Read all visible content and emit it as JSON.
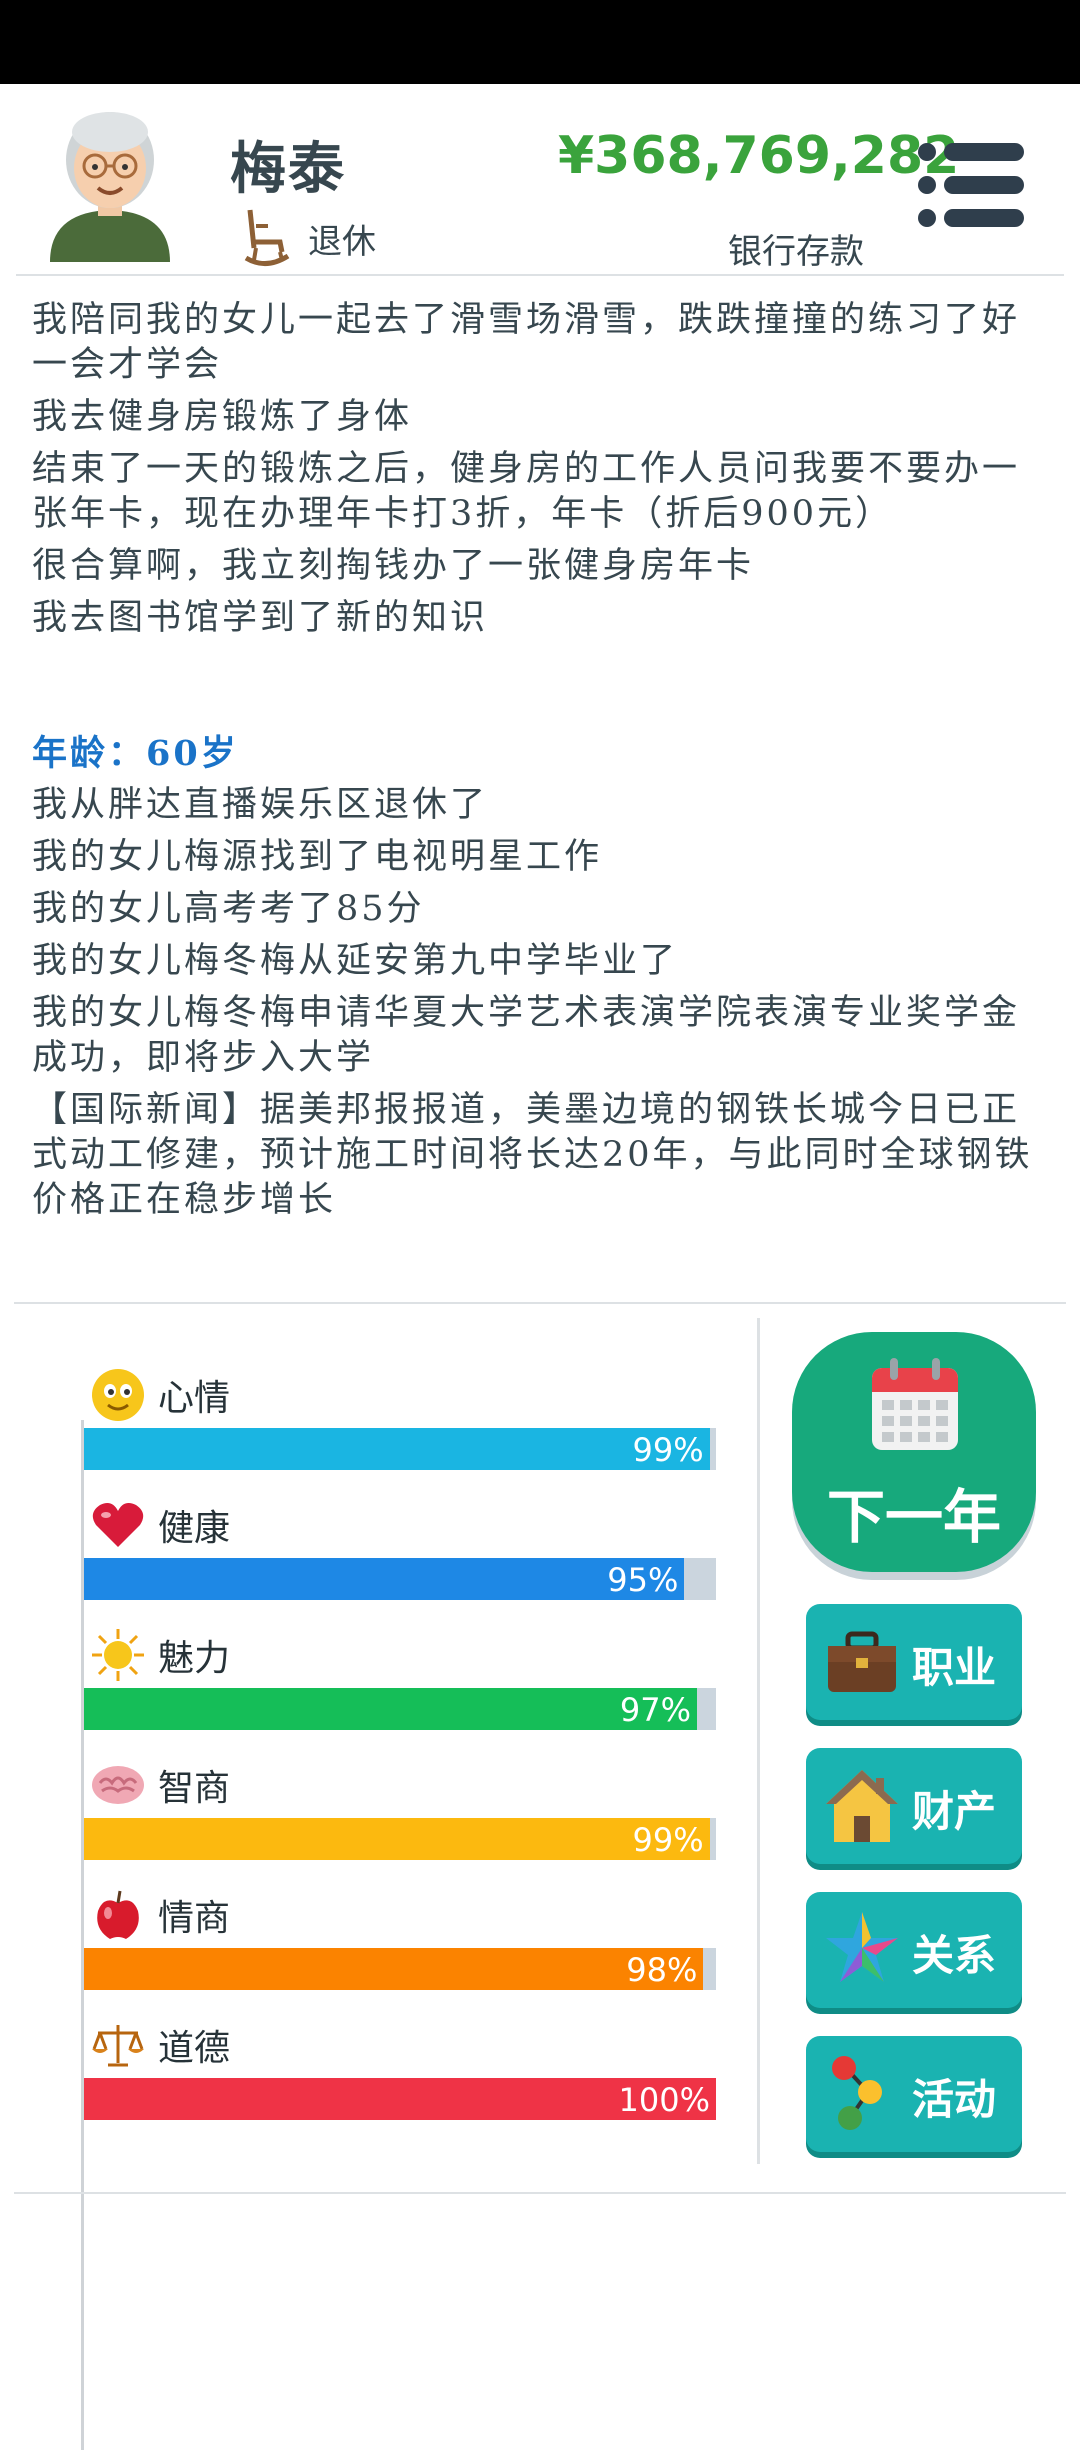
{
  "header": {
    "name": "梅泰",
    "status": "退休",
    "money": "¥368,769,282",
    "money_label": "银行存款"
  },
  "log": {
    "lines_before": [
      "我陪同我的女儿一起去了滑雪场滑雪，跌跌撞撞的练习了好一会才学会",
      "我去健身房锻炼了身体",
      "结束了一天的锻炼之后，健身房的工作人员问我要不要办一张年卡，现在办理年卡打3折，年卡（折后900元）",
      "很合算啊，我立刻掏钱办了一张健身房年卡",
      "我去图书馆学到了新的知识"
    ],
    "age_heading": "年龄：60岁",
    "lines_after": [
      "我从胖达直播娱乐区退休了",
      "我的女儿梅源找到了电视明星工作",
      "我的女儿高考考了85分",
      "我的女儿梅冬梅从延安第九中学毕业了",
      "我的女儿梅冬梅申请华夏大学艺术表演学院表演专业奖学金成功，即将步入大学",
      "【国际新闻】据美邦报报道，美墨边境的钢铁长城今日已正式动工修建，预计施工时间将长达20年，与此同时全球钢铁价格正在稳步增长"
    ]
  },
  "stats": [
    {
      "name": "心情",
      "value": "99%",
      "level": 0.99,
      "color": "#1ab5e2",
      "icon": "smiley-icon"
    },
    {
      "name": "健康",
      "value": "95%",
      "level": 0.95,
      "color": "#1e88e5",
      "icon": "heart-icon"
    },
    {
      "name": "魅力",
      "value": "97%",
      "level": 0.97,
      "color": "#15be58",
      "icon": "sun-icon"
    },
    {
      "name": "智商",
      "value": "99%",
      "level": 0.99,
      "color": "#fcb90f",
      "icon": "brain-icon"
    },
    {
      "name": "情商",
      "value": "98%",
      "level": 0.98,
      "color": "#fb8300",
      "icon": "apple-icon"
    },
    {
      "name": "道德",
      "value": "100%",
      "level": 1.0,
      "color": "#ef3346",
      "icon": "scales-icon"
    }
  ],
  "buttons": {
    "next_year": "下一年",
    "career": "职业",
    "property": "财产",
    "relations": "关系",
    "activities": "活动"
  }
}
